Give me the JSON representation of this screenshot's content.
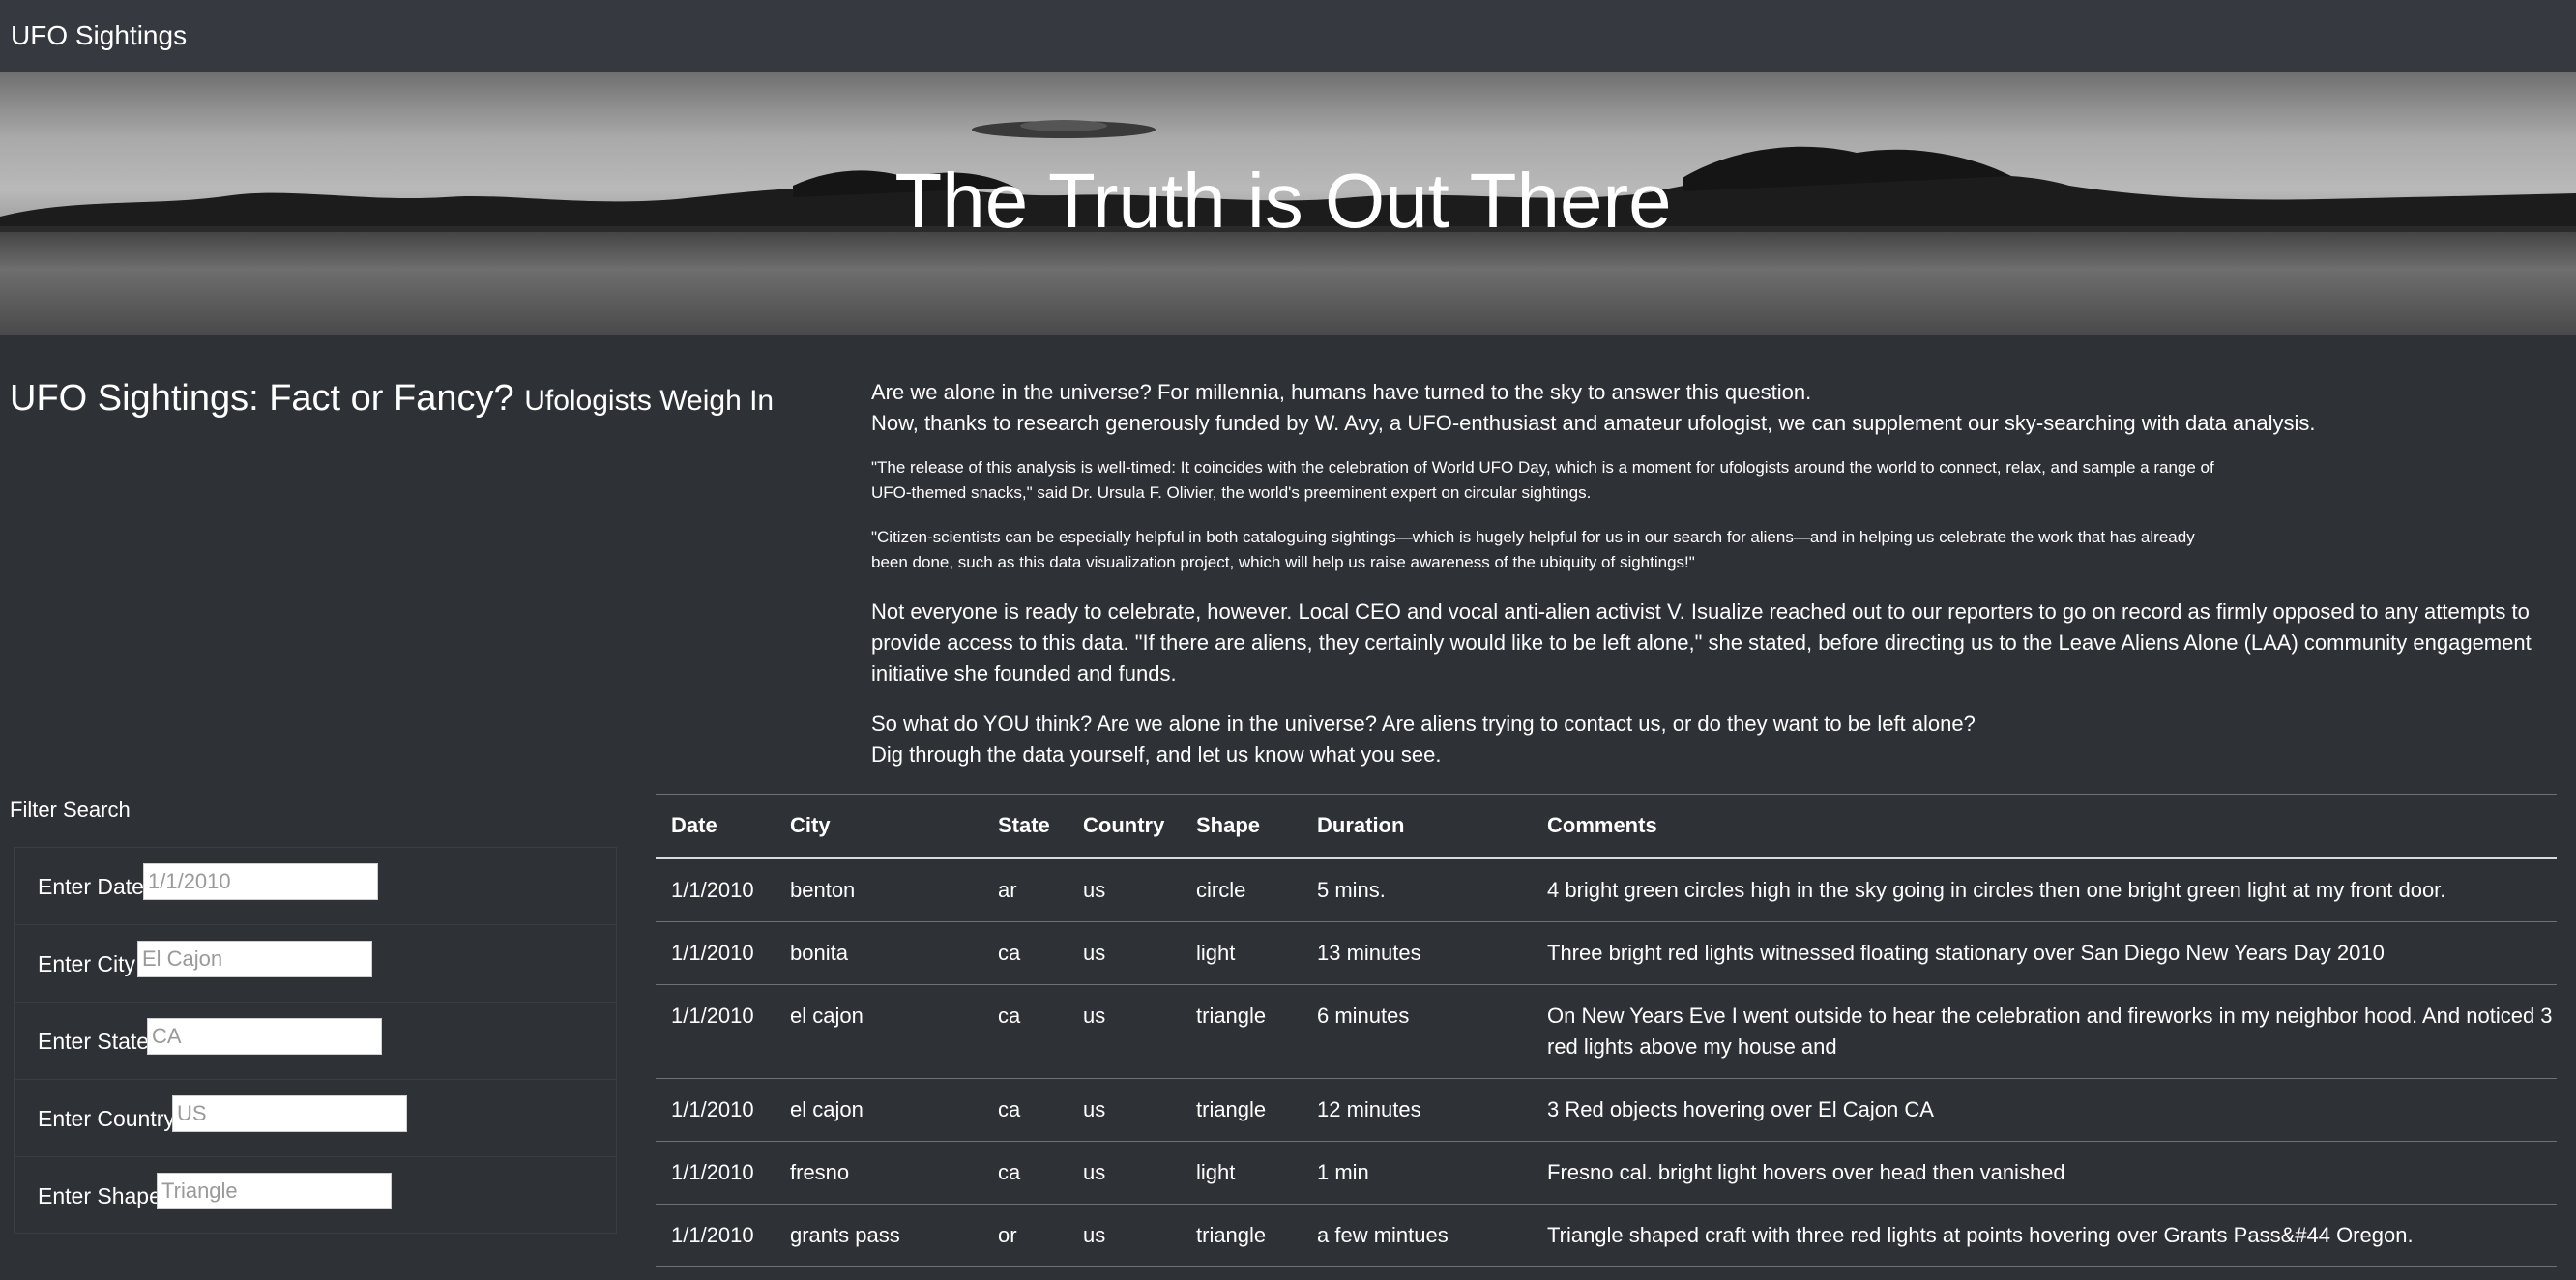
{
  "navbar": {
    "brand": "UFO Sightings"
  },
  "hero": {
    "heading": "The Truth is Out There"
  },
  "article": {
    "title": "UFO Sightings: Fact or Fancy?",
    "subtitle": "Ufologists Weigh In",
    "intro_line1": "Are we alone in the universe? For millennia, humans have turned to the sky to answer this question.",
    "intro_line2": "Now, thanks to research generously funded by W. Avy, a UFO-enthusiast and amateur ufologist, we can supplement our sky-searching with data analysis.",
    "quote1": "\"The release of this analysis is well-timed: It coincides with the celebration of World UFO Day, which is a moment for ufologists around the world to connect, relax, and sample a range of UFO-themed snacks,\" said Dr. Ursula F. Olivier, the world's preeminent expert on circular sightings.",
    "quote2": "\"Citizen-scientists can be especially helpful in both cataloguing sightings—which is hugely helpful for us in our search for aliens—and in helping us celebrate the work that has already been done, such as this data visualization project, which will help us raise awareness of the ubiquity of sightings!\"",
    "para3": "Not everyone is ready to celebrate, however. Local CEO and vocal anti-alien activist V. Isualize reached out to our reporters to go on record as firmly opposed to any attempts to provide access to this data. \"If there are aliens, they certainly would like to be left alone,\" she stated, before directing us to the Leave Aliens Alone (LAA) community engagement initiative she founded and funds.",
    "closing_line1": "So what do YOU think? Are we alone in the universe? Are aliens trying to contact us, or do they want to be left alone?",
    "closing_line2": "Dig through the data yourself, and let us know what you see."
  },
  "filters": {
    "heading": "Filter Search",
    "items": [
      {
        "label": "Enter Date",
        "placeholder": "1/1/2010"
      },
      {
        "label": "Enter City",
        "placeholder": "El Cajon"
      },
      {
        "label": "Enter State",
        "placeholder": "CA"
      },
      {
        "label": "Enter Country",
        "placeholder": "US"
      },
      {
        "label": "Enter Shape",
        "placeholder": "Triangle"
      }
    ]
  },
  "table": {
    "headers": [
      "Date",
      "City",
      "State",
      "Country",
      "Shape",
      "Duration",
      "Comments"
    ],
    "rows": [
      [
        "1/1/2010",
        "benton",
        "ar",
        "us",
        "circle",
        "5 mins.",
        "4 bright green circles high in the sky going in circles then one bright green light at my front door."
      ],
      [
        "1/1/2010",
        "bonita",
        "ca",
        "us",
        "light",
        "13 minutes",
        "Three bright red lights witnessed floating stationary over San Diego New Years Day 2010"
      ],
      [
        "1/1/2010",
        "el cajon",
        "ca",
        "us",
        "triangle",
        "6 minutes",
        "On New Years Eve I went outside to hear the celebration and fireworks in my neighbor hood. And noticed 3 red lights above my house and"
      ],
      [
        "1/1/2010",
        "el cajon",
        "ca",
        "us",
        "triangle",
        "12 minutes",
        "3 Red objects hovering over El Cajon CA"
      ],
      [
        "1/1/2010",
        "fresno",
        "ca",
        "us",
        "light",
        "1 min",
        "Fresno cal. bright light hovers over head then vanished"
      ],
      [
        "1/1/2010",
        "grants pass",
        "or",
        "us",
        "triangle",
        "a few mintues",
        "Triangle shaped craft with three red lights at points hovering over Grants Pass&#44 Oregon."
      ]
    ]
  }
}
